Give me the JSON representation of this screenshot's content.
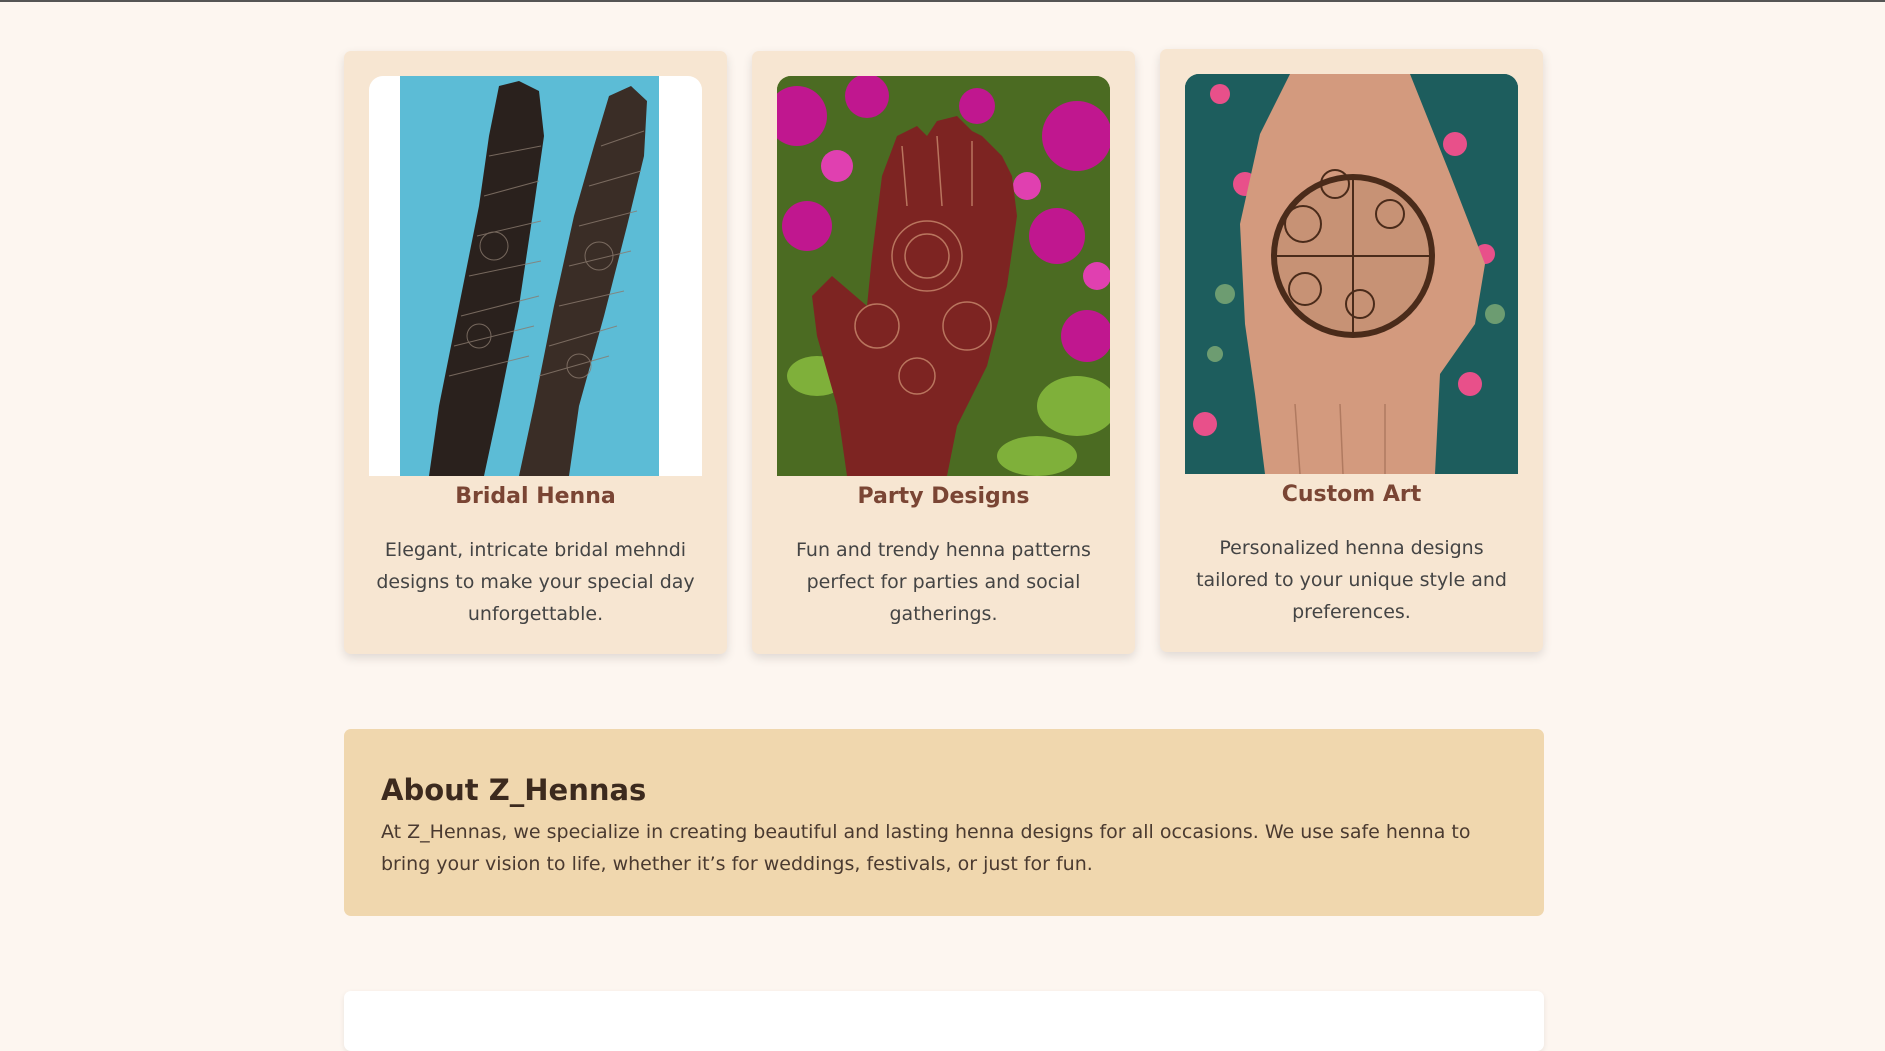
{
  "services": [
    {
      "title": "Bridal Henna",
      "description": "Elegant, intricate bridal mehndi designs to make your special day unforgettable.",
      "image_icon": "bridal-henna-photo"
    },
    {
      "title": "Party Designs",
      "description": "Fun and trendy henna patterns perfect for parties and social gatherings.",
      "image_icon": "party-henna-photo"
    },
    {
      "title": "Custom Art",
      "description": "Personalized henna designs tailored to your unique style and preferences.",
      "image_icon": "custom-henna-photo"
    }
  ],
  "about": {
    "title": "About Z_Hennas",
    "text": "At Z_Hennas, we specialize in creating beautiful and lasting henna designs for all occasions. We use safe henna to bring your vision to life, whether it’s for weddings, festivals, or just for fun."
  },
  "colors": {
    "page_background": "#fdf6f0",
    "card_background": "#f7e6d2",
    "card_title": "#7a4534",
    "about_background": "#f0d7ae"
  }
}
